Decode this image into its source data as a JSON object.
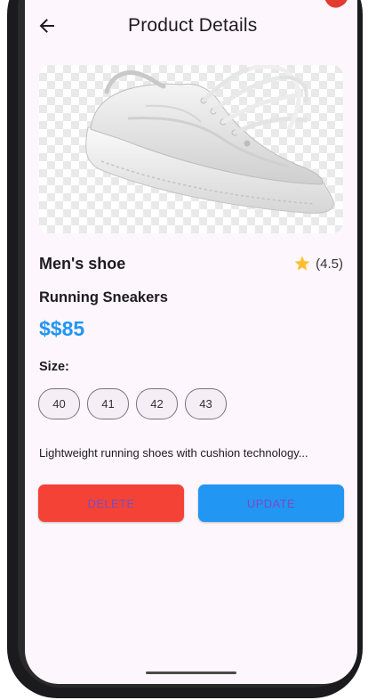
{
  "appbar": {
    "title": "Product Details",
    "back_icon": "arrow-left-icon"
  },
  "product": {
    "image_icon": "sneaker-image",
    "name": "Men's shoe",
    "rating_icon": "star-icon",
    "rating": "(4.5)",
    "subtitle": "Running Sneakers",
    "price": "$$85",
    "size_label": "Size:",
    "sizes": [
      "40",
      "41",
      "42",
      "43"
    ],
    "description": "Lightweight running shoes with cushion technology..."
  },
  "actions": {
    "delete_label": "DELETE",
    "update_label": "UPDATE"
  },
  "colors": {
    "background": "#fdf6fc",
    "price": "#2196f3",
    "delete": "#f44336",
    "update": "#2196f3",
    "button_text": "#7b4bc4",
    "star": "#fbc02d"
  }
}
